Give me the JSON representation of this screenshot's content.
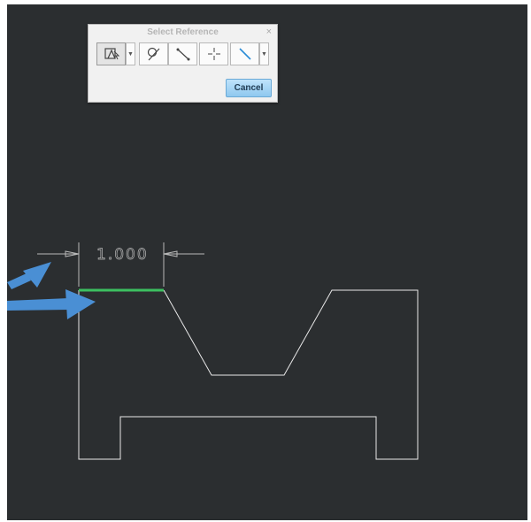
{
  "dialog": {
    "title": "Select Reference",
    "close_glyph": "×",
    "cancel_label": "Cancel",
    "tools": [
      {
        "name": "select-reference-icon",
        "pressed": true,
        "dropdown": true
      },
      {
        "name": "select-arc-icon",
        "pressed": false,
        "dropdown": false
      },
      {
        "name": "select-edge-icon",
        "pressed": false,
        "dropdown": false
      },
      {
        "name": "select-point-icon",
        "pressed": false,
        "dropdown": false
      },
      {
        "name": "select-line-icon",
        "pressed": false,
        "dropdown": true
      }
    ]
  },
  "sketch": {
    "dimension_value": "1.000",
    "colors": {
      "background": "#2b2e30",
      "geometry": "#e8e8e8",
      "highlight": "#3cc060",
      "arrow": "#4a8fd4",
      "dimension": "#b8b8b8"
    }
  }
}
